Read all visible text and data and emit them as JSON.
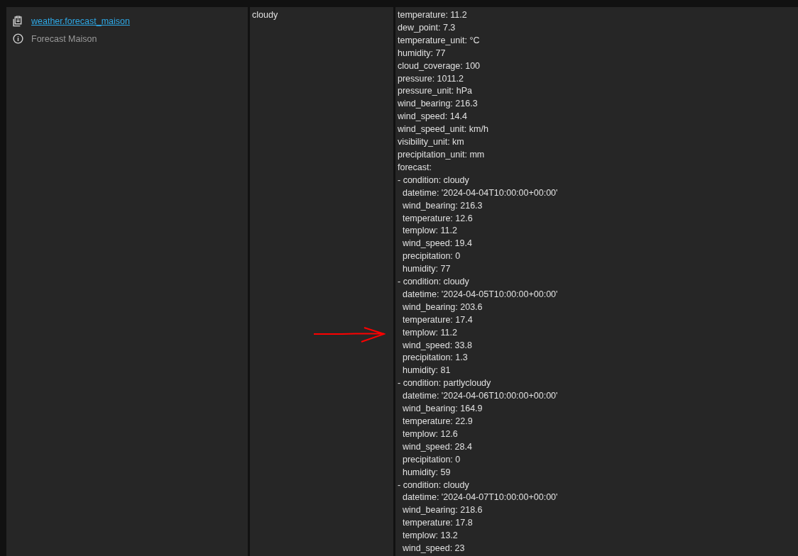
{
  "entity": {
    "entity_id": "weather.forecast_maison",
    "friendly_name": "Forecast Maison"
  },
  "state": "cloudy",
  "attributes": [
    "temperature: 11.2",
    "dew_point: 7.3",
    "temperature_unit: °C",
    "humidity: 77",
    "cloud_coverage: 100",
    "pressure: 1011.2",
    "pressure_unit: hPa",
    "wind_bearing: 216.3",
    "wind_speed: 14.4",
    "wind_speed_unit: km/h",
    "visibility_unit: km",
    "precipitation_unit: mm",
    "forecast:",
    "- condition: cloudy",
    "  datetime: '2024-04-04T10:00:00+00:00'",
    "  wind_bearing: 216.3",
    "  temperature: 12.6",
    "  templow: 11.2",
    "  wind_speed: 19.4",
    "  precipitation: 0",
    "  humidity: 77",
    "- condition: cloudy",
    "  datetime: '2024-04-05T10:00:00+00:00'",
    "  wind_bearing: 203.6",
    "  temperature: 17.4",
    "  templow: 11.2",
    "  wind_speed: 33.8",
    "  precipitation: 1.3",
    "  humidity: 81",
    "- condition: partlycloudy",
    "  datetime: '2024-04-06T10:00:00+00:00'",
    "  wind_bearing: 164.9",
    "  temperature: 22.9",
    "  templow: 12.6",
    "  wind_speed: 28.4",
    "  precipitation: 0",
    "  humidity: 59",
    "- condition: cloudy",
    "  datetime: '2024-04-07T10:00:00+00:00'",
    "  wind_bearing: 218.6",
    "  temperature: 17.8",
    "  templow: 13.2",
    "  wind_speed: 23"
  ]
}
